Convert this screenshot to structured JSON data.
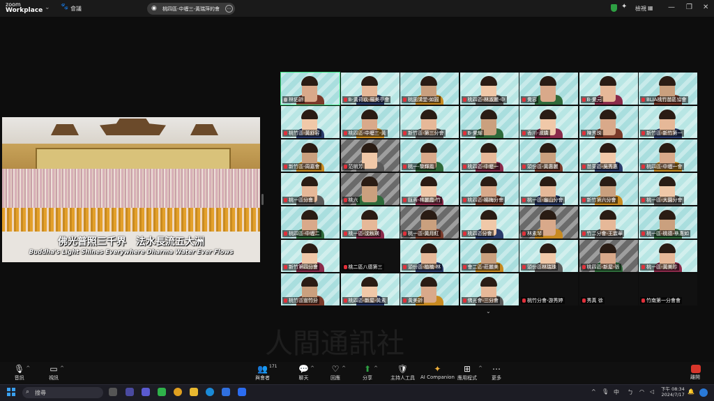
{
  "titlebar": {
    "logo_line1": "zoom",
    "logo_line2": "Workplace",
    "meeting_label": "會議",
    "active_speaker": "桃四區-中壢三-黃瑞萍的會",
    "view_label": "檢視",
    "accent_green": "#36e07c"
  },
  "share": {
    "caption_zh": "佛光普照三千界　法水長流五大洲",
    "caption_en": "Buddha's Light Shines Everywhere Dharma Water Ever Flows"
  },
  "gallery": {
    "tiles": [
      {
        "name": "林佑齡",
        "type": "person",
        "mic": false
      },
      {
        "name": "B-黃荷玖-楊美亭會",
        "type": "person",
        "mic": true
      },
      {
        "name": "桃園講堂-如圓",
        "type": "person",
        "mic": true
      },
      {
        "name": "桃四區-林淑麗-中",
        "type": "person",
        "mic": true
      },
      {
        "name": "覺容",
        "type": "person",
        "mic": true
      },
      {
        "name": "B-覺元",
        "type": "person",
        "mic": true
      },
      {
        "name": "BLIA桃竹苗區協會",
        "type": "person",
        "mic": true
      },
      {
        "name": "桃竹區-黃舒容",
        "type": "person",
        "mic": true
      },
      {
        "name": "桃四區-中壢三-黃",
        "type": "person",
        "mic": true
      },
      {
        "name": "新竹區-第三分會",
        "type": "person",
        "mic": true
      },
      {
        "name": "B-覺耀",
        "type": "person",
        "mic": true
      },
      {
        "name": "香川-淑嬌",
        "type": "person",
        "mic": true
      },
      {
        "name": "陳秀珠",
        "type": "person",
        "mic": true
      },
      {
        "name": "新竹區-新竹第一",
        "type": "person",
        "mic": true
      },
      {
        "name": "新竹區-周嘉會",
        "type": "person",
        "mic": true
      },
      {
        "name": "范明芳",
        "type": "photo",
        "mic": true
      },
      {
        "name": "桃一-黎輝鳳",
        "type": "person",
        "mic": true
      },
      {
        "name": "桃四區-中壢一",
        "type": "person",
        "mic": true
      },
      {
        "name": "頭份區-黃惠麗",
        "type": "person",
        "mic": true
      },
      {
        "name": "苗栗區-吳秀惠",
        "type": "person",
        "mic": true
      },
      {
        "name": "桃四區-中壢一會",
        "type": "person",
        "mic": true
      },
      {
        "name": "桃一區分會",
        "type": "person",
        "mic": true
      },
      {
        "name": "桃六",
        "type": "photo",
        "mic": true
      },
      {
        "name": "甌蓉-林麗霞-竹",
        "type": "person",
        "mic": true
      },
      {
        "name": "桃四區-楊梅分會",
        "type": "person",
        "mic": true
      },
      {
        "name": "桃一區-龜山分會",
        "type": "person",
        "mic": true
      },
      {
        "name": "新竹第六分會",
        "type": "person",
        "mic": true
      },
      {
        "name": "桃一區-大園分會",
        "type": "person",
        "mic": true
      },
      {
        "name": "桃四區-中壢二",
        "type": "person",
        "mic": true
      },
      {
        "name": "桃一區-沈秋瑛",
        "type": "person",
        "mic": true
      },
      {
        "name": "桃一區-黃月紅",
        "type": "photo",
        "mic": true
      },
      {
        "name": "桃四區分會",
        "type": "person",
        "mic": true
      },
      {
        "name": "林素琴",
        "type": "photo",
        "mic": true
      },
      {
        "name": "竹二分會-王震華",
        "type": "person",
        "mic": true
      },
      {
        "name": "桃一區-桃德-蔡惠如",
        "type": "person",
        "mic": true
      },
      {
        "name": "新竹第四分會",
        "type": "person",
        "mic": true
      },
      {
        "name": "桃二區八德第三",
        "type": "dark",
        "mic": true
      },
      {
        "name": "頭份區-植楠-林",
        "type": "person",
        "mic": true
      },
      {
        "name": "會二區-莊麗美",
        "type": "person",
        "mic": true
      },
      {
        "name": "頭份區林瑞珠",
        "type": "person",
        "mic": true
      },
      {
        "name": "桃四區-新屋-張",
        "type": "photo",
        "mic": true
      },
      {
        "name": "桃一區-黃美珍",
        "type": "person",
        "mic": true
      },
      {
        "name": "桃竹區宣竹分",
        "type": "person",
        "mic": true
      },
      {
        "name": "桃四區-新屋-黃素",
        "type": "person",
        "mic": true
      },
      {
        "name": "黃美齡",
        "type": "person",
        "mic": true
      },
      {
        "name": "佛光會-三分會",
        "type": "person",
        "mic": true
      },
      {
        "name": "桃竹分會-游秀婷",
        "type": "dark",
        "mic": true
      },
      {
        "name": "秀真 徐",
        "type": "dark",
        "mic": true
      },
      {
        "name": "竹南第一分會會",
        "type": "dark",
        "mic": true
      }
    ]
  },
  "toolbar": {
    "audio": "音訊",
    "video": "視訊",
    "participants": "與會者",
    "participants_count": "171",
    "chat": "聊天",
    "reactions": "回應",
    "share": "分享",
    "host_tools": "主持人工具",
    "ai": "AI Companion",
    "apps": "應用程式",
    "more": "更多",
    "leave": "離開"
  },
  "taskbar": {
    "search": "搜尋",
    "ime": "中",
    "time": "下午 08:34",
    "date": "2024/7/17"
  }
}
